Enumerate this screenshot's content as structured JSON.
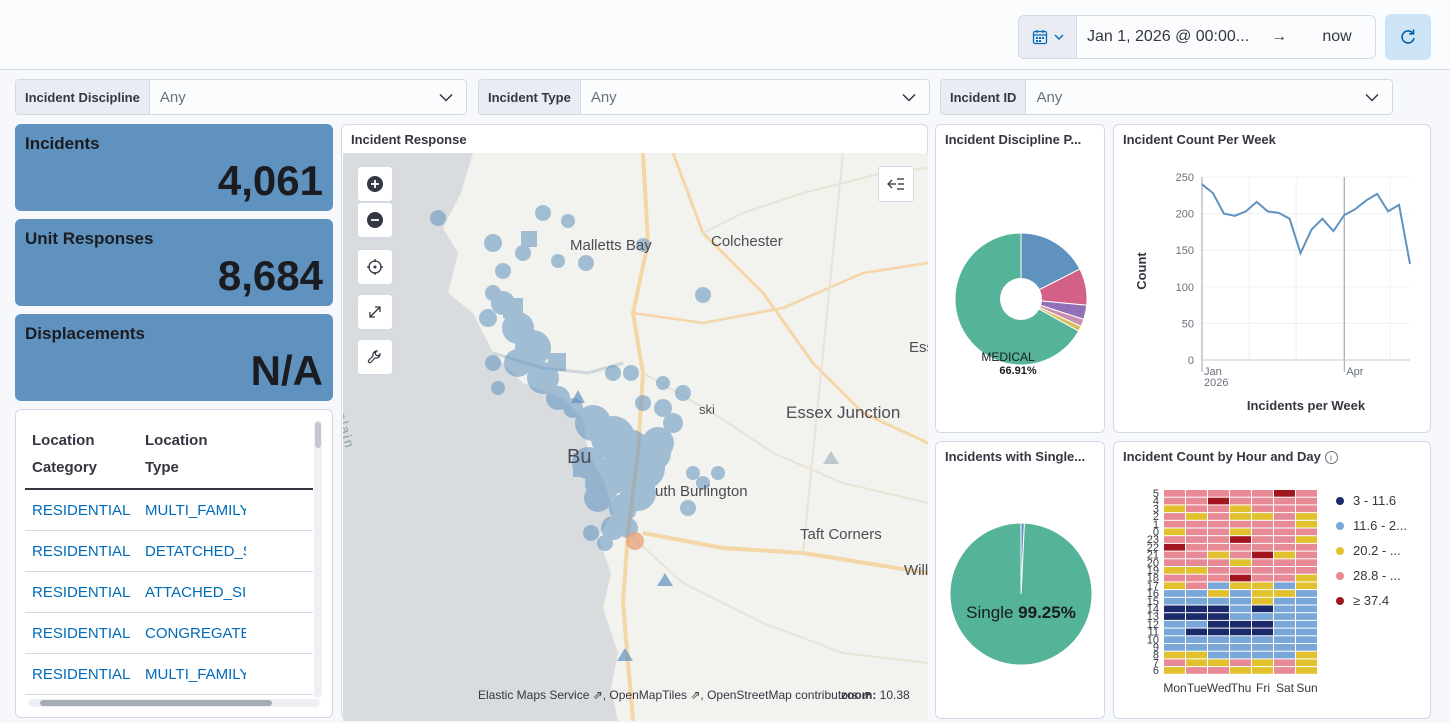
{
  "timepicker": {
    "start": "Jan 1, 2026 @ 00:00...",
    "arrow": "→",
    "end": "now",
    "calendar_icon": "calendar-icon",
    "refresh_icon": "refresh-icon"
  },
  "filters": [
    {
      "label": "Incident Discipline",
      "value": "Any"
    },
    {
      "label": "Incident Type",
      "value": "Any"
    },
    {
      "label": "Incident ID",
      "value": "Any"
    }
  ],
  "metrics": [
    {
      "title": "Incidents",
      "value": "4,061"
    },
    {
      "title": "Unit Responses",
      "value": "8,684"
    },
    {
      "title": "Displacements",
      "value": "N/A"
    }
  ],
  "location_table": {
    "headers": [
      [
        "Location",
        "Category"
      ],
      [
        "Location",
        "Type"
      ]
    ],
    "rows": [
      [
        "RESIDENTIAL",
        "MULTI_FAMILY"
      ],
      [
        "RESIDENTIAL",
        "DETATCHED_S"
      ],
      [
        "RESIDENTIAL",
        "ATTACHED_SI"
      ],
      [
        "RESIDENTIAL",
        "CONGREGATE"
      ],
      [
        "RESIDENTIAL",
        "MULTI_FAMILY"
      ]
    ]
  },
  "map": {
    "title": "Incident Response",
    "places": [
      "Malletts Bay",
      "Colchester",
      "Ess",
      "Essex Junction",
      "Bu",
      "uth Burlington",
      "Taft Corners",
      "Will",
      "ski",
      "ke Champlain"
    ],
    "zoom_label": "zoom:",
    "zoom_value": "10.38",
    "attribution": "Elastic Maps Service ⇗, OpenMapTiles ⇗, OpenStreetMap contributors ⇗"
  },
  "panels": {
    "discipline_title": "Incident Discipline P...",
    "weekly_title": "Incident Count Per Week",
    "single_title": "Incidents with Single...",
    "heatmap_title": "Incident Count by Hour and Day"
  },
  "chart_data": [
    {
      "type": "pie",
      "title": "Incident Discipline P...",
      "slices": [
        {
          "label": "MEDICAL",
          "value": 66.91,
          "color": "#54b399"
        },
        {
          "label": "",
          "value": 17.5,
          "color": "#6092c0"
        },
        {
          "label": "",
          "value": 9.0,
          "color": "#d36086"
        },
        {
          "label": "",
          "value": 3.5,
          "color": "#9170b8"
        },
        {
          "label": "",
          "value": 1.8,
          "color": "#ca8eae"
        },
        {
          "label": "",
          "value": 1.29,
          "color": "#d6bf57"
        }
      ],
      "label_text": "MEDICAL",
      "label_pct": "66.91%"
    },
    {
      "type": "line",
      "title": "Incident Count Per Week",
      "xlabel": "Incidents per Week",
      "ylabel": "Count",
      "ylim": [
        0,
        250
      ],
      "yticks": [
        0,
        50,
        100,
        150,
        200,
        250
      ],
      "xticks": [
        {
          "label": "Jan",
          "sub": "2026",
          "week": 0
        },
        {
          "label": "Apr",
          "sub": "",
          "week": 13
        }
      ],
      "x_week": [
        0,
        1,
        2,
        3,
        4,
        5,
        6,
        7,
        8,
        9,
        10,
        11,
        12,
        13,
        14,
        15,
        16,
        17,
        18,
        19,
        20,
        21
      ],
      "values": [
        240,
        228,
        200,
        197,
        203,
        216,
        203,
        201,
        193,
        146,
        178,
        193,
        176,
        198,
        206,
        218,
        227,
        203,
        212,
        131
      ],
      "color": "#6092c0"
    },
    {
      "type": "pie",
      "title": "Incidents with Single...",
      "slices": [
        {
          "label": "Single",
          "value": 99.25,
          "color": "#54b399"
        },
        {
          "label": "",
          "value": 0.75,
          "color": "#6092c0"
        }
      ],
      "label_text": "Single",
      "label_pct": "99.25%"
    },
    {
      "type": "heatmap",
      "title": "Incident Count by Hour and Day",
      "days": [
        "Mon",
        "Tue",
        "Wed",
        "Thu",
        "Fri",
        "Sat",
        "Sun"
      ],
      "hours": [
        "5",
        "4",
        "3",
        "2",
        "1",
        "0",
        "23",
        "22",
        "21",
        "20",
        "19",
        "18",
        "17",
        "16",
        "15",
        "14",
        "13",
        "12",
        "11",
        "10",
        "9",
        "8",
        "7",
        "6"
      ],
      "legend": [
        {
          "label": "3 - 11.6",
          "color": "#1b2a6b"
        },
        {
          "label": "11.6 - 2...",
          "color": "#79a7d8"
        },
        {
          "label": "20.2 - ...",
          "color": "#e1c22e"
        },
        {
          "label": "28.8 - ...",
          "color": "#e88a96"
        },
        {
          "label": "≥ 37.4",
          "color": "#a2171f"
        }
      ],
      "levels": [
        [
          3,
          3,
          3,
          3,
          3,
          4,
          3
        ],
        [
          3,
          3,
          4,
          3,
          3,
          3,
          3
        ],
        [
          2,
          3,
          3,
          2,
          3,
          3,
          3
        ],
        [
          3,
          2,
          3,
          2,
          2,
          3,
          2
        ],
        [
          3,
          3,
          3,
          3,
          3,
          3,
          2
        ],
        [
          2,
          3,
          3,
          2,
          3,
          3,
          3
        ],
        [
          3,
          3,
          3,
          4,
          3,
          3,
          2
        ],
        [
          4,
          3,
          3,
          3,
          3,
          3,
          3
        ],
        [
          3,
          3,
          2,
          3,
          4,
          2,
          3
        ],
        [
          3,
          3,
          3,
          2,
          3,
          3,
          3
        ],
        [
          2,
          2,
          3,
          3,
          3,
          3,
          3
        ],
        [
          3,
          3,
          3,
          4,
          3,
          3,
          2
        ],
        [
          2,
          3,
          1,
          2,
          2,
          1,
          2
        ],
        [
          1,
          1,
          2,
          1,
          2,
          2,
          1
        ],
        [
          1,
          1,
          1,
          1,
          2,
          1,
          1
        ],
        [
          0,
          0,
          0,
          1,
          0,
          1,
          1
        ],
        [
          0,
          0,
          0,
          1,
          1,
          1,
          1
        ],
        [
          1,
          1,
          0,
          0,
          0,
          1,
          1
        ],
        [
          1,
          0,
          0,
          0,
          0,
          1,
          1
        ],
        [
          1,
          1,
          1,
          1,
          1,
          1,
          1
        ],
        [
          1,
          1,
          1,
          1,
          1,
          1,
          1
        ],
        [
          2,
          2,
          1,
          1,
          1,
          1,
          2
        ],
        [
          3,
          2,
          2,
          3,
          2,
          3,
          2
        ],
        [
          2,
          3,
          3,
          2,
          2,
          3,
          2
        ]
      ]
    }
  ]
}
